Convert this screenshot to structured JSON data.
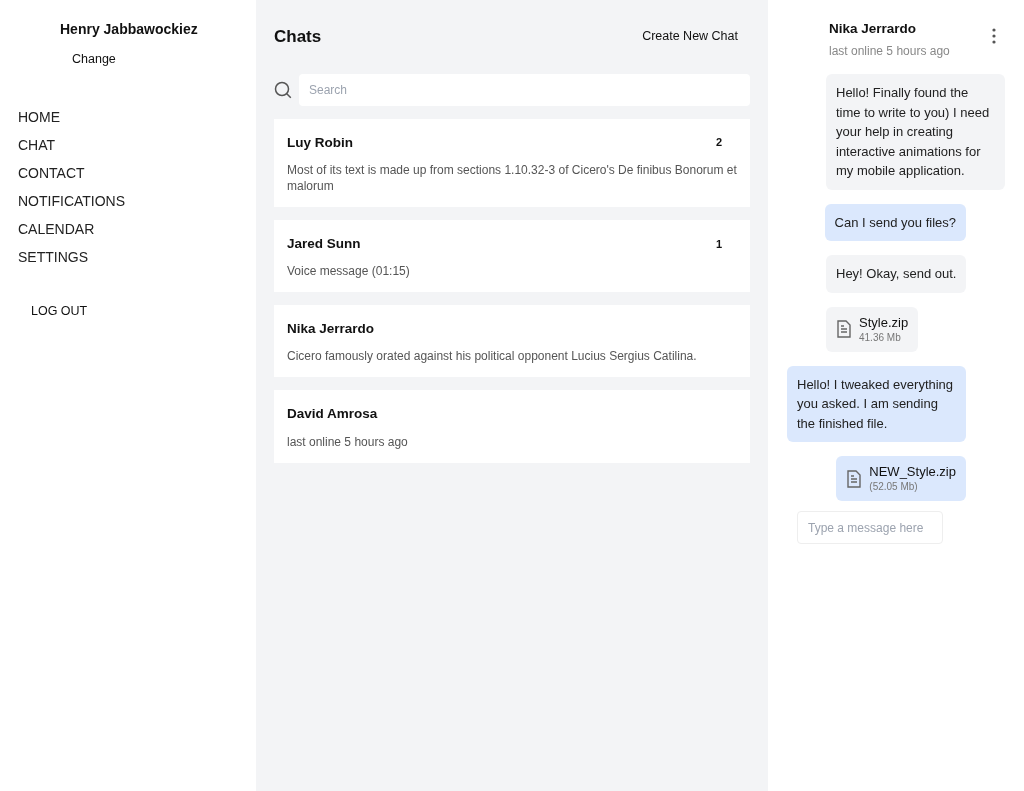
{
  "profile": {
    "name": "Henry Jabbawockiez",
    "change_link": "Change"
  },
  "nav": {
    "items": [
      "HOME",
      "CHAT",
      "CONTACT",
      "NOTIFICATIONS",
      "CALENDAR",
      "SETTINGS"
    ],
    "logout": "LOG OUT"
  },
  "chats": {
    "title": "Chats",
    "create_button": "Create New Chat",
    "search": {
      "placeholder": "Search"
    },
    "items": [
      {
        "name": "Luy Robin",
        "preview": "Most of its text is made up from sections 1.10.32-3 of Cicero's De finibus Bonorum et malorum",
        "unread": "2"
      },
      {
        "name": "Jared Sunn",
        "preview": "Voice message (01:15)",
        "unread": "1"
      },
      {
        "name": "Nika Jerrardo",
        "preview": "Cicero famously orated against his political opponent Lucius Sergius Catilina."
      },
      {
        "name": "David Amrosa",
        "preview": "last online 5 hours ago"
      }
    ]
  },
  "conversation": {
    "contact": "Nika Jerrardo",
    "status": "last online 5 hours ago",
    "messages": [
      {
        "kind": "text",
        "outgoing": false,
        "text": "Hello! Finally found the time to write to you) I need your help in creating interactive animations for my mobile application."
      },
      {
        "kind": "text",
        "outgoing": true,
        "text": "Can I send you files?"
      },
      {
        "kind": "text",
        "outgoing": false,
        "text": "Hey! Okay, send out."
      },
      {
        "kind": "file",
        "outgoing": false,
        "file_name": "Style.zip",
        "size": "41.36 Mb"
      },
      {
        "kind": "text",
        "outgoing": true,
        "text": "Hello! I tweaked everything you asked. I am sending the finished file."
      },
      {
        "kind": "file",
        "outgoing": true,
        "file_name": "NEW_Style.zip",
        "size": "(52.05 Mb)"
      }
    ],
    "composer": {
      "placeholder": "Type a message here"
    }
  }
}
